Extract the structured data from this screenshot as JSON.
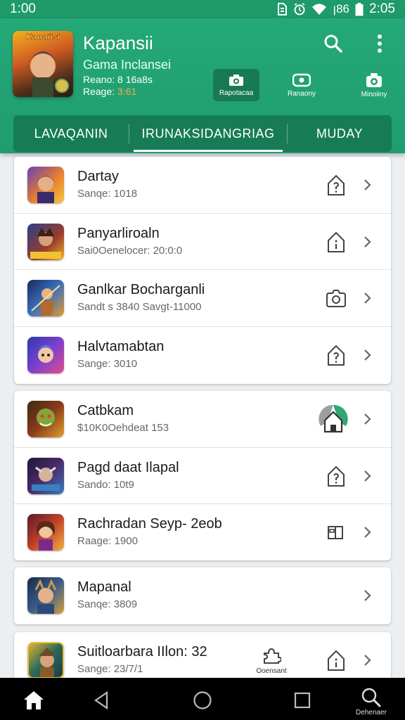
{
  "status_bar": {
    "time_left": "1:00",
    "network": "ꞁ86",
    "time_right": "2:05"
  },
  "header": {
    "cover_logo_text": "Kanaiisi",
    "title": "Kapansii",
    "subtitle": "Gama Inclansei",
    "meta1": "Reano: 8 16a8s",
    "meta2_label": "Reage:",
    "meta2_value": "3:61",
    "actions": [
      {
        "label": "Rapotacaa",
        "active": true
      },
      {
        "label": "Ranaony",
        "active": false
      },
      {
        "label": "Minoiiny",
        "active": false
      }
    ]
  },
  "tabs": [
    {
      "label": "LAVAQANIN",
      "active": false
    },
    {
      "label": "IRUNAKSIDANGRIAG",
      "active": true
    },
    {
      "label": "MUDAY",
      "active": false
    }
  ],
  "cards": [
    {
      "rows": [
        {
          "title": "Dartay",
          "subtitle": "Sanqe: 1018",
          "icon": "house-question-icon"
        },
        {
          "title": "Panyarliroaln",
          "subtitle": "Sai0Oenelocer: 20:0:0",
          "icon": "house-info-icon"
        },
        {
          "title": "Ganlkar Bocharganli",
          "subtitle": "Sandt s 3840   Savgt-11000",
          "icon": "camera-gear-icon"
        },
        {
          "title": "Halvtamabtan",
          "subtitle": "Sange: 3010",
          "icon": "house-question-icon"
        }
      ]
    },
    {
      "rows": [
        {
          "title": "Catbkam",
          "subtitle": "$10K0Oehdeat 153",
          "icon": "house-badge-icon"
        },
        {
          "title": "Pagd daat Ilapal",
          "subtitle": "Sando: 10t9",
          "icon": "house-question-icon"
        },
        {
          "title": "Rachradan Seyp- 2eob",
          "subtitle": "Raage: 1900",
          "icon": "door-icon"
        }
      ]
    },
    {
      "rows": [
        {
          "title": "Mapanal",
          "subtitle": "Sanqe: 3809"
        }
      ]
    },
    {
      "rows": [
        {
          "title": "Suitloarbara IIlon: 32",
          "subtitle": "Sange: 23/7/1",
          "mid_label": "Ooensant",
          "icon": "house-info-icon"
        }
      ]
    }
  ],
  "bottom_nav": {
    "last_label": "Dehenaer"
  }
}
